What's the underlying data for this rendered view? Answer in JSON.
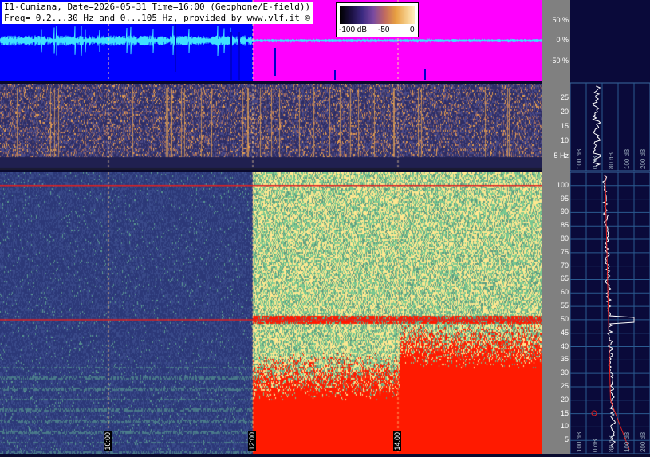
{
  "header": {
    "line1": "I1-Cumiana, Date=2026-05-31 Time=16:00 (Geophone/E-field))",
    "line2": "Freq= 0.2...30 Hz and 0...105 Hz, provided by www.vlf.it ©"
  },
  "color_scale": {
    "labels": [
      "-100 dB",
      "-50",
      "0"
    ]
  },
  "colors": {
    "waveform_bg_before": "#0000ff",
    "waveform_bg_after": "#ff00ff",
    "waveform_trace": "#40e0ff",
    "spectrogram_low_bg": "#2a3a7a",
    "saturation_red": "#ff1a00",
    "hot_yellow": "#ffe890",
    "green": "#7ac890",
    "marker_line": "#e02020"
  },
  "chart_data": [
    {
      "type": "line",
      "panel": "waveform",
      "ylabel": "",
      "ytick_labels": [
        "50 %",
        "0 %",
        "-50 %"
      ],
      "yticks": [
        50,
        0,
        -50
      ],
      "ylim": [
        -100,
        100
      ]
    },
    {
      "type": "heatmap",
      "panel": "low-frequency spectrogram",
      "ytick_labels": [
        "25",
        "20",
        "15",
        "10",
        "5 Hz"
      ],
      "yticks": [
        25,
        20,
        15,
        10,
        5
      ],
      "ylim": [
        0.2,
        30
      ]
    },
    {
      "type": "heatmap",
      "panel": "high-frequency spectrogram",
      "ytick_labels": [
        "100",
        "95",
        "90",
        "85",
        "80",
        "75",
        "70",
        "65",
        "60",
        "55",
        "50",
        "45",
        "40",
        "35",
        "30",
        "25",
        "20",
        "15",
        "10",
        "5"
      ],
      "yticks": [
        100,
        95,
        90,
        85,
        80,
        75,
        70,
        65,
        60,
        55,
        50,
        45,
        40,
        35,
        30,
        25,
        20,
        15,
        10,
        5
      ],
      "ylim": [
        0,
        105
      ],
      "time_labels": [
        "10:00",
        "12:00",
        "14:00"
      ],
      "time_hours": [
        10,
        12,
        14
      ],
      "time_range_hours": [
        8.5,
        16
      ],
      "transition_hour": 12.0
    },
    {
      "type": "line",
      "panel": "spectrum profiles",
      "xtick_labels_top": [
        "100 dB",
        "0 dB",
        "80 dB",
        "100 dB",
        "200 dB"
      ],
      "xtick_labels_bottom": [
        "100 dB",
        "0 dB",
        "80 dB",
        "100 dB",
        "200 dB"
      ],
      "peak_hz": 50
    }
  ]
}
